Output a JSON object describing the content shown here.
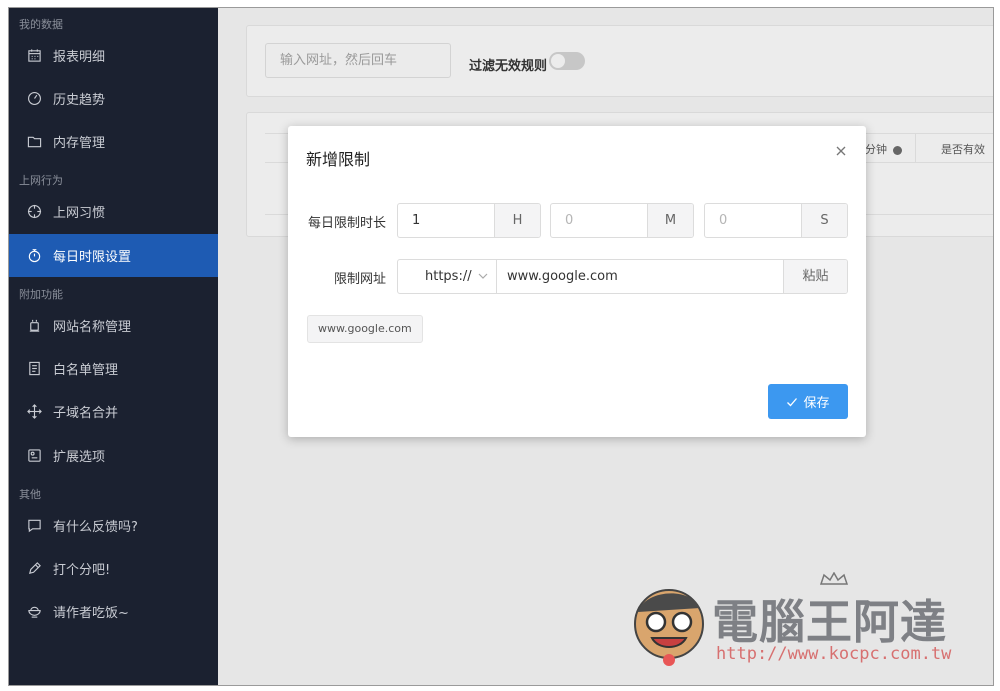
{
  "sidebar": {
    "sections": [
      {
        "title": "我的数据"
      },
      {
        "title": "上网行为"
      },
      {
        "title": "附加功能"
      },
      {
        "title": "其他"
      }
    ],
    "items": [
      {
        "label": "报表明细"
      },
      {
        "label": "历史趋势"
      },
      {
        "label": "内存管理"
      },
      {
        "label": "上网习惯"
      },
      {
        "label": "每日时限设置"
      },
      {
        "label": "网站名称管理"
      },
      {
        "label": "白名单管理"
      },
      {
        "label": "子域名合并"
      },
      {
        "label": "扩展选项"
      },
      {
        "label": "有什么反馈吗?"
      },
      {
        "label": "打个分吧!"
      },
      {
        "label": "请作者吃饭~"
      }
    ]
  },
  "toolbar": {
    "search_placeholder": "输入网址，然后回车",
    "filter_label": "过滤无效规则"
  },
  "table": {
    "headers": [
      "分钟",
      "是否有效"
    ]
  },
  "modal": {
    "title": "新增限制",
    "daily_limit_label": "每日限制时长",
    "hours": {
      "value": "1",
      "unit": "H"
    },
    "minutes": {
      "placeholder": "0",
      "unit": "M"
    },
    "seconds": {
      "placeholder": "0",
      "unit": "S"
    },
    "url_label": "限制网址",
    "protocol": "https://",
    "url_value": "www.google.com",
    "paste_label": "粘贴",
    "tag": "www.google.com",
    "save_label": "保存"
  },
  "watermark": {
    "name": "電腦王阿達",
    "url": "http://www.kocpc.com.tw"
  },
  "colors": {
    "sidebar_bg": "#1b2130",
    "active_item": "#1e5bb3",
    "primary_button": "#3c98f0"
  }
}
